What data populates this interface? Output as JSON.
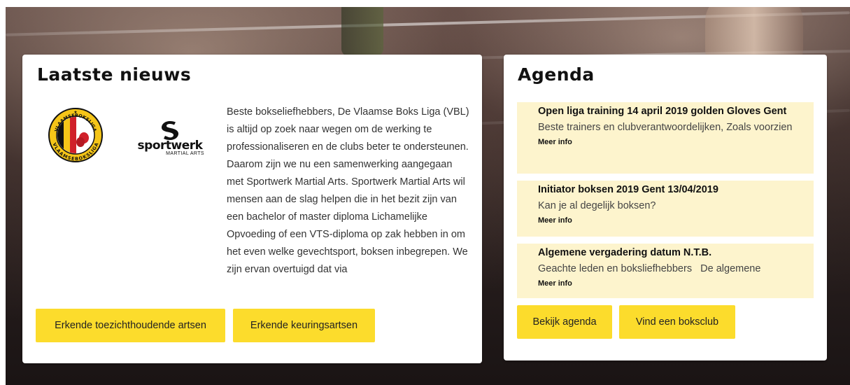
{
  "news": {
    "title": "Laatste nieuws",
    "body": "Beste bokseliefhebbers, De Vlaamse Boks Liga (VBL) is altijd op zoek naar wegen om de werking te professionaliseren en de clubs beter te ondersteunen. Daarom zijn we nu een samenwerking aangegaan met Sportwerk Martial Arts. Sportwerk Martial Arts wil mensen aan de slag helpen die in het bezit zijn van een bachelor of master diploma Lichamelijke Opvoeding of een VTS-diploma op zak hebben in om het even welke gevechtsport, boksen inbegrepen. We zijn ervan overtuigd dat via",
    "logos": {
      "vbl_ring_text_top": "VLAAMSEBOKSLIGA",
      "vbl_ring_text_bottom": "VLAAMSEBOKSLIGA",
      "sportwerk_word": "sportwerk",
      "sportwerk_sub": "MARTIAL ARTS"
    },
    "buttons": {
      "doctors": "Erkende toezichthoudende artsen",
      "keuring": "Erkende keuringsartsen"
    }
  },
  "agenda": {
    "title": "Agenda",
    "events": [
      {
        "title": "Open liga training 14 april 2019 golden Gloves Gent",
        "description": "Beste trainers en clubverantwoordelijken, Zoals voorzien",
        "more": "Meer info"
      },
      {
        "title": "Initiator boksen 2019 Gent 13/04/2019",
        "description": "Kan je al degelijk boksen?",
        "more": "Meer info"
      },
      {
        "title": "Algemene vergadering datum N.T.B.",
        "description": "Geachte leden en boksliefhebbers   De algemene",
        "more": "Meer info"
      }
    ],
    "buttons": {
      "agenda": "Bekijk agenda",
      "club": "Vind een boksclub"
    }
  },
  "colors": {
    "button": "#fcdc2c",
    "event_bg": "#fdf4cd",
    "vbl_yellow": "#f5c518",
    "vbl_red": "#d0202a",
    "vbl_black": "#111111"
  },
  "icons": {
    "vbl_logo": "vlaamse-boks-liga-logo",
    "sportwerk_logo": "sportwerk-logo"
  }
}
